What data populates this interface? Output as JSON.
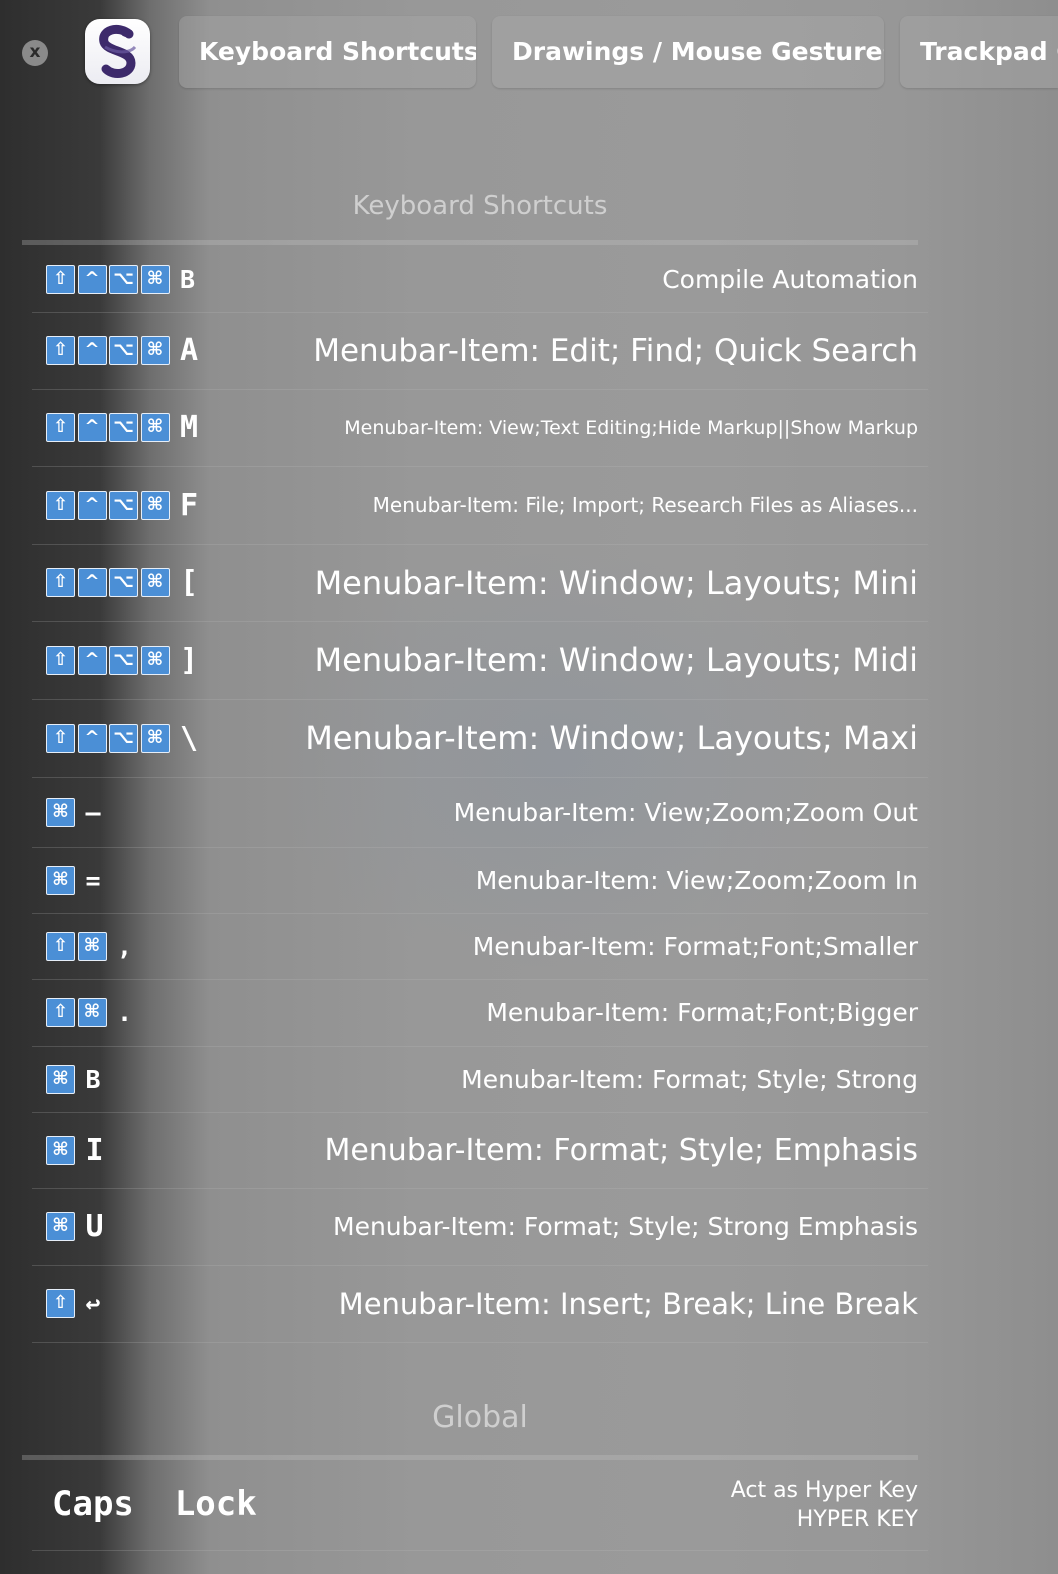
{
  "window": {
    "close_glyph": "x",
    "app_icon": "scrivener-icon",
    "tabs": [
      {
        "label": "Keyboard Shortcuts"
      },
      {
        "label": "Drawings / Mouse Gestures"
      },
      {
        "label": "Trackpad G"
      }
    ]
  },
  "sections": {
    "shortcuts_title": "Keyboard Shortcuts",
    "global_title": "Global"
  },
  "modifier_glyphs": {
    "shift": "⇧",
    "control": "^",
    "option": "⌥",
    "command": "⌘"
  },
  "colors": {
    "modifier_key_bg": "#4b8fd6",
    "text": "#ffffff"
  },
  "shortcuts": [
    {
      "key": "B",
      "action": "Compile Automation"
    },
    {
      "key": "A",
      "action": "Menubar-Item: Edit; Find; Quick Search"
    },
    {
      "key": "M",
      "action": "Menubar-Item: View;Text Editing;Hide Markup||Show Markup"
    },
    {
      "key": "F",
      "action": "Menubar-Item: File; Import; Research Files as Aliases..."
    },
    {
      "key": "[",
      "action": "Menubar-Item: Window; Layouts; Mini"
    },
    {
      "key": "]",
      "action": "Menubar-Item: Window; Layouts; Midi"
    },
    {
      "key": "\\",
      "action": "Menubar-Item: Window; Layouts; Maxi"
    },
    {
      "key": "–",
      "action": "Menubar-Item: View;Zoom;Zoom Out"
    },
    {
      "key": "=",
      "action": "Menubar-Item: View;Zoom;Zoom In"
    },
    {
      "key": ",",
      "action": "Menubar-Item: Format;Font;Smaller"
    },
    {
      "key": ".",
      "action": "Menubar-Item: Format;Font;Bigger"
    },
    {
      "key": "B",
      "action": "Menubar-Item: Format; Style; Strong"
    },
    {
      "key": "I",
      "action": "Menubar-Item: Format; Style; Emphasis"
    },
    {
      "key": "U",
      "action": "Menubar-Item: Format; Style; Strong Emphasis"
    },
    {
      "key": "↩",
      "action": "Menubar-Item: Insert; Break; Line Break"
    }
  ],
  "global": {
    "trigger": "Caps  Lock",
    "action": "Act as Hyper Key",
    "action_detail": "HYPER KEY"
  }
}
